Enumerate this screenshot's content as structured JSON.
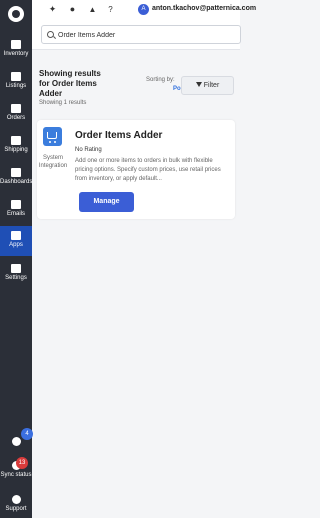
{
  "sidebar": {
    "items": [
      {
        "label": "Inventory"
      },
      {
        "label": "Listings"
      },
      {
        "label": "Orders"
      },
      {
        "label": "Shipping"
      },
      {
        "label": "Dashboards"
      },
      {
        "label": "Emails"
      },
      {
        "label": "Apps"
      },
      {
        "label": "Settings"
      }
    ],
    "bottom": {
      "notifications_count": "4",
      "sync_label": "Sync status",
      "sync_count": "13",
      "support_label": "Support"
    },
    "colors": {
      "bg": "#2b2f38",
      "active": "#1f4fb5"
    }
  },
  "topbar": {
    "avatar_letter": "A",
    "user_email": "anton.tkachov@patternica.com"
  },
  "search": {
    "value": "Order Items Adder"
  },
  "results": {
    "title": "Showing results for Order Items Adder",
    "count": "Showing 1 results",
    "sorting_label": "Sorting by:",
    "sorting_value": "Po",
    "filter_label": "Filter"
  },
  "card": {
    "icon": "cart-icon",
    "type_label": "System Integration",
    "title": "Order Items Adder",
    "rating": "No Rating",
    "description": "Add one or more items to orders in bulk with flexible pricing options. Specify custom prices, use retail prices from inventory, or apply default...",
    "manage_label": "Manage"
  },
  "accent_color": "#3b5ed6"
}
